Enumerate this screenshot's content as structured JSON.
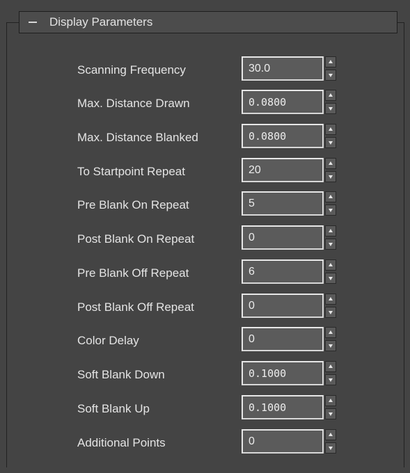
{
  "rollout": {
    "title": "Display Parameters",
    "collapse_icon": "minus-icon",
    "parameters": [
      {
        "label": "Scanning Frequency",
        "value": "30.0",
        "mono": false
      },
      {
        "label": "Max. Distance Drawn",
        "value": "0.0800",
        "mono": true
      },
      {
        "label": "Max. Distance Blanked",
        "value": "0.0800",
        "mono": true
      },
      {
        "label": "To Startpoint Repeat",
        "value": "20",
        "mono": false
      },
      {
        "label": "Pre Blank On Repeat",
        "value": "5",
        "mono": false
      },
      {
        "label": "Post Blank On Repeat",
        "value": "0",
        "mono": false
      },
      {
        "label": "Pre Blank Off Repeat",
        "value": "6",
        "mono": false
      },
      {
        "label": "Post Blank Off Repeat",
        "value": "0",
        "mono": false
      },
      {
        "label": "Color Delay",
        "value": "0",
        "mono": false
      },
      {
        "label": "Soft Blank Down",
        "value": "0.1000",
        "mono": true
      },
      {
        "label": "Soft Blank Up",
        "value": "0.1000",
        "mono": true
      },
      {
        "label": "Additional Points",
        "value": "0",
        "mono": false
      }
    ]
  },
  "theme": {
    "panel_bg": "#444444",
    "text_color": "#e4e4e4",
    "input_bg": "#5b5b5b",
    "input_border": "#e7e7e7"
  }
}
